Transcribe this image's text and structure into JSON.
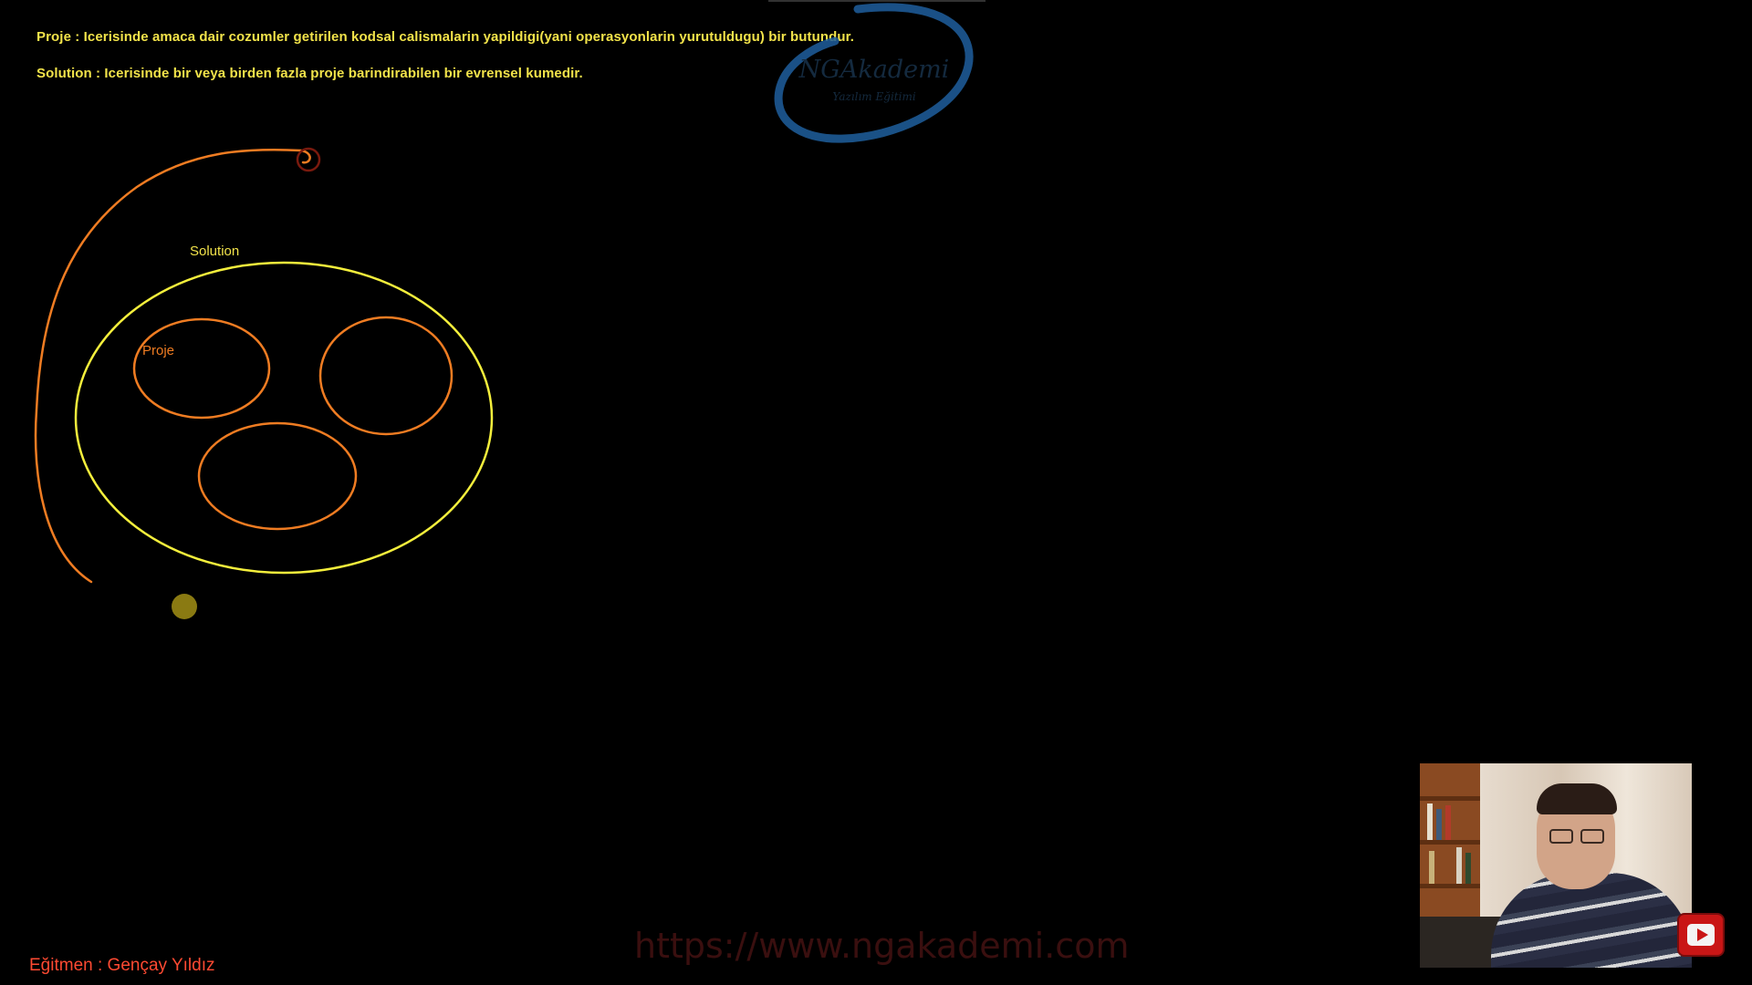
{
  "definitions": {
    "proje": "Proje : Icerisinde amaca dair cozumler getirilen kodsal calismalarin yapildigi(yani operasyonlarin yurutuldugu) bir butundur.",
    "solution": "Solution : Icerisinde bir veya birden fazla proje barindirabilen bir evrensel kumedir."
  },
  "diagram": {
    "solution_label": "Solution",
    "proje_label": "Proje"
  },
  "logo": {
    "name": "NGAkademi",
    "tagline": "Yazılım Eğitimi"
  },
  "footer": {
    "url": "https://www.ngakademi.com",
    "instructor": "Eğitmen : Gençay Yıldız"
  },
  "colors": {
    "background": "#000000",
    "definition_text": "#f2e34a",
    "solution_ellipse": "#f4ef3c",
    "project_ellipse": "#ef7c22",
    "instructor_text": "#ff4a32",
    "logo_swoosh": "#1f5f9e"
  },
  "icons": {
    "youtube": "youtube-play-icon",
    "pen_cursor": "pen-cursor-icon"
  }
}
